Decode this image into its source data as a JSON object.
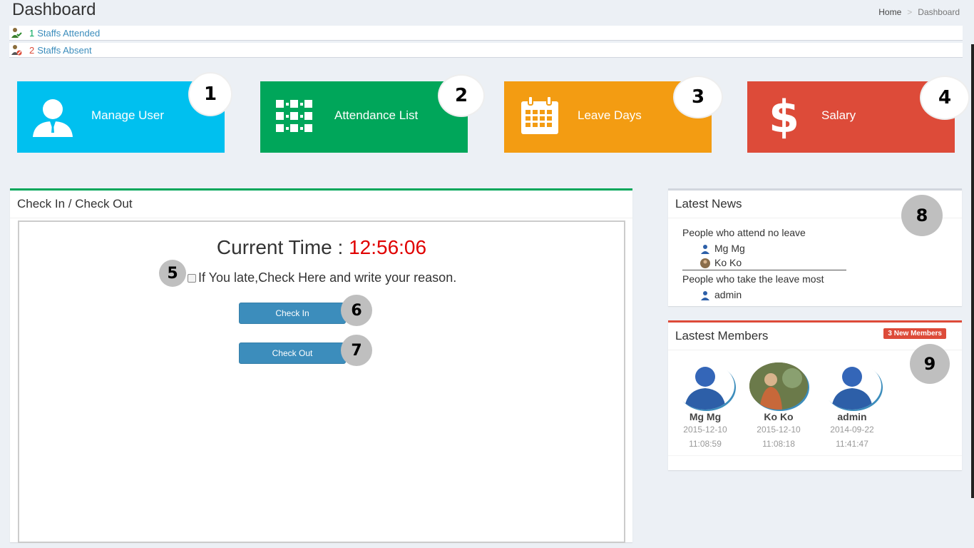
{
  "header": {
    "title": "Dashboard",
    "breadcrumb": {
      "home": "Home",
      "current": "Dashboard"
    }
  },
  "stats": [
    {
      "count": "1",
      "label": "Staffs Attended",
      "icon": "user-check-icon",
      "color": "#00a65a"
    },
    {
      "count": "2",
      "label": "Staffs Absent",
      "icon": "user-blocked-icon",
      "color": "#dd4b39"
    }
  ],
  "tiles": [
    {
      "label": "Manage User",
      "icon": "user-icon",
      "color": "#00c0ef",
      "callout": "1"
    },
    {
      "label": "Attendance List",
      "icon": "list-icon",
      "color": "#00a65a",
      "callout": "2"
    },
    {
      "label": "Leave Days",
      "icon": "calendar-icon",
      "color": "#f39c12",
      "callout": "3"
    },
    {
      "label": "Salary",
      "icon": "dollar-icon",
      "color": "#dd4b39",
      "callout": "4"
    }
  ],
  "checkin": {
    "title": "Check In / Check Out",
    "time_label": "Current Time :",
    "time_value": "12:56:06",
    "late_text": "If You late,Check Here and write your reason.",
    "check_in_label": "Check In",
    "check_out_label": "Check Out",
    "callouts": {
      "late": "5",
      "check_in": "6",
      "check_out": "7"
    }
  },
  "news": {
    "title": "Latest News",
    "callout": "8",
    "groups": [
      {
        "heading": "People who attend no leave",
        "people": [
          "Mg Mg",
          "Ko Ko"
        ]
      },
      {
        "heading": "People who take the leave most",
        "people": [
          "admin"
        ]
      }
    ]
  },
  "members": {
    "title": "Lastest Members",
    "badge": "3 New Members",
    "callout": "9",
    "list": [
      {
        "name": "Mg Mg",
        "date": "2015-12-10",
        "time": "11:08:59"
      },
      {
        "name": "Ko Ko",
        "date": "2015-12-10",
        "time": "11:08:18"
      },
      {
        "name": "admin",
        "date": "2014-09-22",
        "time": "11:41:47"
      }
    ]
  }
}
